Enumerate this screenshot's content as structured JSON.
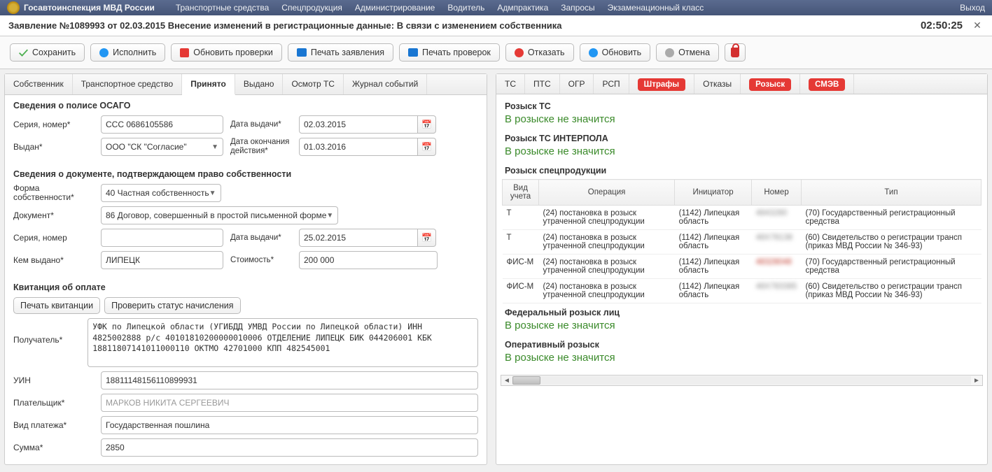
{
  "app": {
    "org": "Госавтоинспекция МВД России"
  },
  "menu": {
    "items": [
      "Транспортные средства",
      "Спецпродукция",
      "Администрирование",
      "Водитель",
      "Адмпрактика",
      "Запросы",
      "Экзаменационный класс"
    ],
    "right": [
      "Выход"
    ]
  },
  "header": {
    "title": "Заявление №1089993 от 02.03.2015 Внесение изменений в регистрационные данные: В связи с изменением собственника",
    "clock": "02:50:25"
  },
  "toolbar": {
    "save": "Сохранить",
    "execute": "Исполнить",
    "refresh_checks": "Обновить проверки",
    "print_app": "Печать заявления",
    "print_checks": "Печать проверок",
    "reject": "Отказать",
    "refresh": "Обновить",
    "cancel": "Отмена"
  },
  "left_tabs": [
    "Собственник",
    "Транспортное средство",
    "Принято",
    "Выдано",
    "Осмотр ТС",
    "Журнал событий"
  ],
  "left_active_tab": 2,
  "osago": {
    "heading": "Сведения о полисе ОСАГО",
    "series_num_label": "Серия, номер*",
    "series_num": "ССС 0686105586",
    "issue_date_label": "Дата выдачи*",
    "issue_date": "02.03.2015",
    "issued_by_label": "Выдан*",
    "issued_by": "ООО \"СК \"Согласие\"",
    "expiry_label": "Дата окончания действия*",
    "expiry": "01.03.2016"
  },
  "ownership": {
    "heading": "Сведения о документе, подтверждающем право собственности",
    "form_label": "Форма собственности*",
    "form": "40 Частная собственность",
    "doc_label": "Документ*",
    "doc": "86 Договор, совершенный в простой письменной форме",
    "series_num_label": "Серия, номер",
    "series_num": "",
    "issue_date_label": "Дата выдачи*",
    "issue_date": "25.02.2015",
    "issued_by_label": "Кем выдано*",
    "issued_by": "ЛИПЕЦК",
    "cost_label": "Стоимость*",
    "cost": "200 000"
  },
  "payment": {
    "heading": "Квитанция об оплате",
    "print_receipt": "Печать квитанции",
    "check_status": "Проверить статус начисления",
    "recipient_label": "Получатель*",
    "recipient": "УФК по Липецкой области (УГИБДД УМВД России по Липецкой области) ИНН 4825002888 р/с 40101810200000010006 ОТДЕЛЕНИЕ ЛИПЕЦК БИК 044206001 КБК 18811807141011000110 ОКТМО 42701000 КПП 482545001",
    "uin_label": "УИН",
    "uin": "18811148156110899931",
    "payer_label": "Плательщик*",
    "payer": "МАРКОВ НИКИТА СЕРГЕЕВИЧ",
    "ptype_label": "Вид платежа*",
    "ptype": "Государственная пошлина",
    "sum_label": "Сумма*",
    "sum": "2850"
  },
  "right_tabs": {
    "plain": [
      "ТС",
      "ПТС",
      "ОГР",
      "РСП"
    ],
    "red1": "Штрафы",
    "plain2": "Отказы",
    "red2": "Розыск",
    "red3": "СМЭВ"
  },
  "rosysk": {
    "h1": "Розыск ТС",
    "s1": "В розыске не значится",
    "h2": "Розыск ТС ИНТЕРПОЛА",
    "s2": "В розыске не значится",
    "h3": "Розыск спецпродукции",
    "cols": {
      "kind": "Вид учета",
      "op": "Операция",
      "init": "Инициатор",
      "num": "Номер",
      "type": "Тип"
    },
    "rows": [
      {
        "kind": "Т",
        "op": "(24) постановка в розыск утраченной спецпродукции",
        "init": "(1142) Липецкая область",
        "num": "4843280",
        "type": "(70) Государственный регистрационный средства"
      },
      {
        "kind": "Т",
        "op": "(24) постановка в розыск утраченной спецпродукции",
        "init": "(1142) Липецкая область",
        "num": "48Х78138",
        "type": "(60) Свидетельство о регистрации трансп (приказ МВД России № 346-93)"
      },
      {
        "kind": "ФИС-М",
        "op": "(24) постановка в розыск утраченной спецпродукции",
        "init": "(1142) Липецкая область",
        "num": "48328048",
        "type": "(70) Государственный регистрационный средства"
      },
      {
        "kind": "ФИС-М",
        "op": "(24) постановка в розыск утраченной спецпродукции",
        "init": "(1142) Липецкая область",
        "num": "48Х783385",
        "type": "(60) Свидетельство о регистрации трансп (приказ МВД России № 346-93)"
      }
    ],
    "h4": "Федеральный розыск лиц",
    "s4": "В розыске не значится",
    "h5": "Оперативный розыск",
    "s5": "В розыске не значится"
  }
}
